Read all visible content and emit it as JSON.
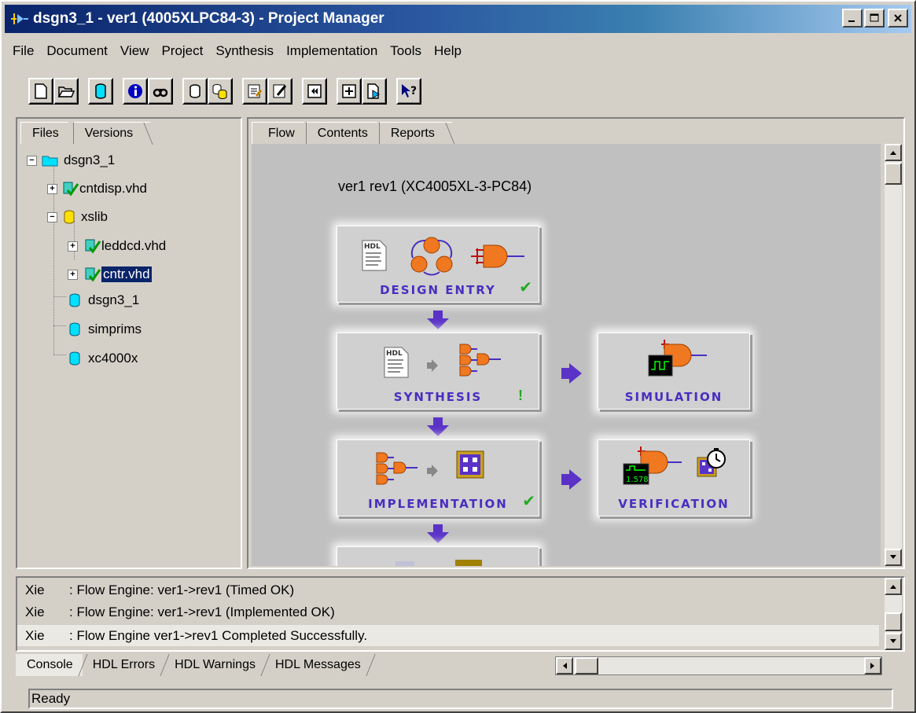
{
  "window": {
    "title": "dsgn3_1 - ver1 (4005XLPC84-3) - Project Manager",
    "controls": [
      "_",
      "□",
      "X"
    ]
  },
  "menu": [
    "File",
    "Document",
    "View",
    "Project",
    "Synthesis",
    "Implementation",
    "Tools",
    "Help"
  ],
  "toolbar": {
    "buttons": [
      "new-document-icon",
      "open-folder-icon",
      "library-icon",
      "info-icon",
      "find-icon",
      "add-library-icon",
      "copy-libraries-icon",
      "edit-properties-icon",
      "edit-source-icon",
      "step-into-icon",
      "add-file-icon",
      "remove-file-icon",
      "context-help-icon"
    ]
  },
  "left_panel": {
    "tabs": [
      "Files",
      "Versions"
    ],
    "tree": [
      {
        "label": "dsgn3_1",
        "icon": "folder-icon",
        "expand": "−"
      },
      {
        "label": "cntdisp.vhd",
        "icon": "vhdl-file-check-icon",
        "expand": "+"
      },
      {
        "label": "xslib",
        "icon": "library-icon",
        "expand": "−"
      },
      {
        "label": "leddcd.vhd",
        "icon": "vhdl-file-check-icon",
        "expand": "+"
      },
      {
        "label": "cntr.vhd",
        "icon": "vhdl-file-check-icon",
        "expand": "+",
        "selected": true
      },
      {
        "label": "dsgn3_1",
        "icon": "library-icon"
      },
      {
        "label": "simprims",
        "icon": "library-icon"
      },
      {
        "label": "xc4000x",
        "icon": "library-icon"
      }
    ]
  },
  "right_panel": {
    "tabs": [
      "Flow",
      "Contents",
      "Reports"
    ],
    "flow_title": "ver1  rev1 (XC4005XL-3-PC84)",
    "boxes": {
      "design_entry": "DESIGN ENTRY",
      "synthesis": "SYNTHESIS",
      "simulation": "SIMULATION",
      "implementation": "IMPLEMENTATION",
      "verification": "VERIFICATION"
    },
    "hdl_badge": "HDL",
    "timing_readout": "1.578"
  },
  "console": {
    "rows": [
      {
        "who": "Xie",
        "msg": ": Flow Engine: ver1->rev1 (Timed OK)"
      },
      {
        "who": "Xie",
        "msg": ": Flow Engine: ver1->rev1 (Implemented OK)"
      },
      {
        "who": "Xie",
        "msg": ": Flow Engine ver1->rev1 Completed Successfully."
      }
    ],
    "tabs": [
      "Console",
      "HDL Errors",
      "HDL Warnings",
      "HDL Messages"
    ]
  },
  "status": "Ready",
  "colors": {
    "title_blue": "#0a246a",
    "flow_purple": "#5a32c8",
    "label_purple": "#4a2ec0",
    "check_green": "#22aa22",
    "gate_orange": "#f07820"
  }
}
